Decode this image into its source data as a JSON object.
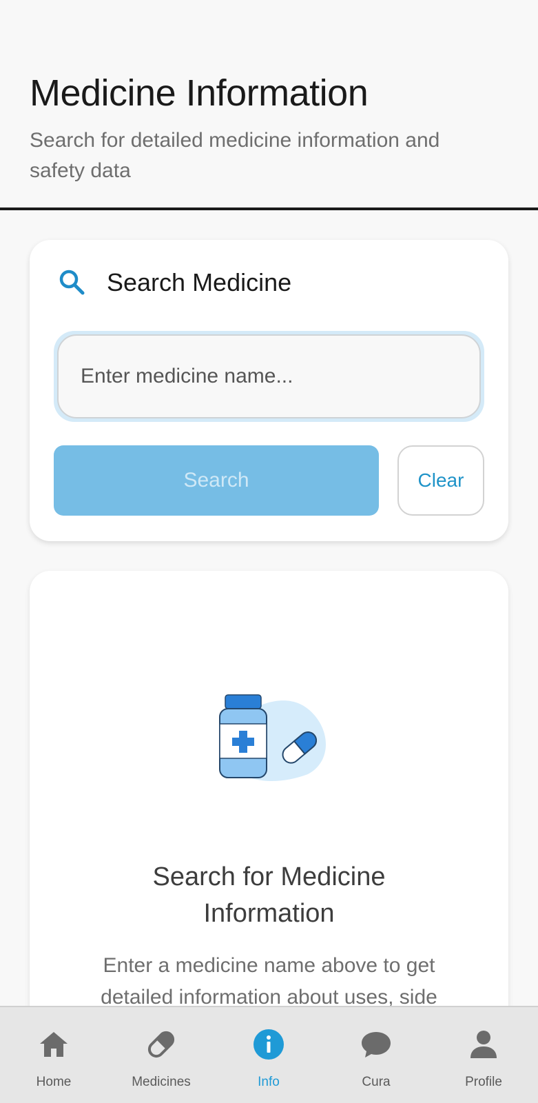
{
  "header": {
    "title": "Medicine Information",
    "subtitle": "Search for detailed medicine information and safety data"
  },
  "search_card": {
    "icon": "search-icon",
    "title": "Search Medicine",
    "input": {
      "value": "",
      "placeholder": "Enter medicine name..."
    },
    "search_label": "Search",
    "clear_label": "Clear"
  },
  "empty_state": {
    "illustration": "medicine-bottle-pill-illustration",
    "title": "Search for Medicine Information",
    "description": "Enter a medicine name above to get detailed information about uses, side"
  },
  "bottom_nav": {
    "items": [
      {
        "label": "Home",
        "icon": "home-icon"
      },
      {
        "label": "Medicines",
        "icon": "pill-icon"
      },
      {
        "label": "Info",
        "icon": "info-icon",
        "active": true
      },
      {
        "label": "Cura",
        "icon": "chat-bubble-icon"
      },
      {
        "label": "Profile",
        "icon": "person-icon"
      }
    ]
  },
  "colors": {
    "accent": "#1f9ad6",
    "search_button_disabled": "#76bde5",
    "background": "#f8f8f8",
    "nav_background": "#e6e6e6"
  }
}
